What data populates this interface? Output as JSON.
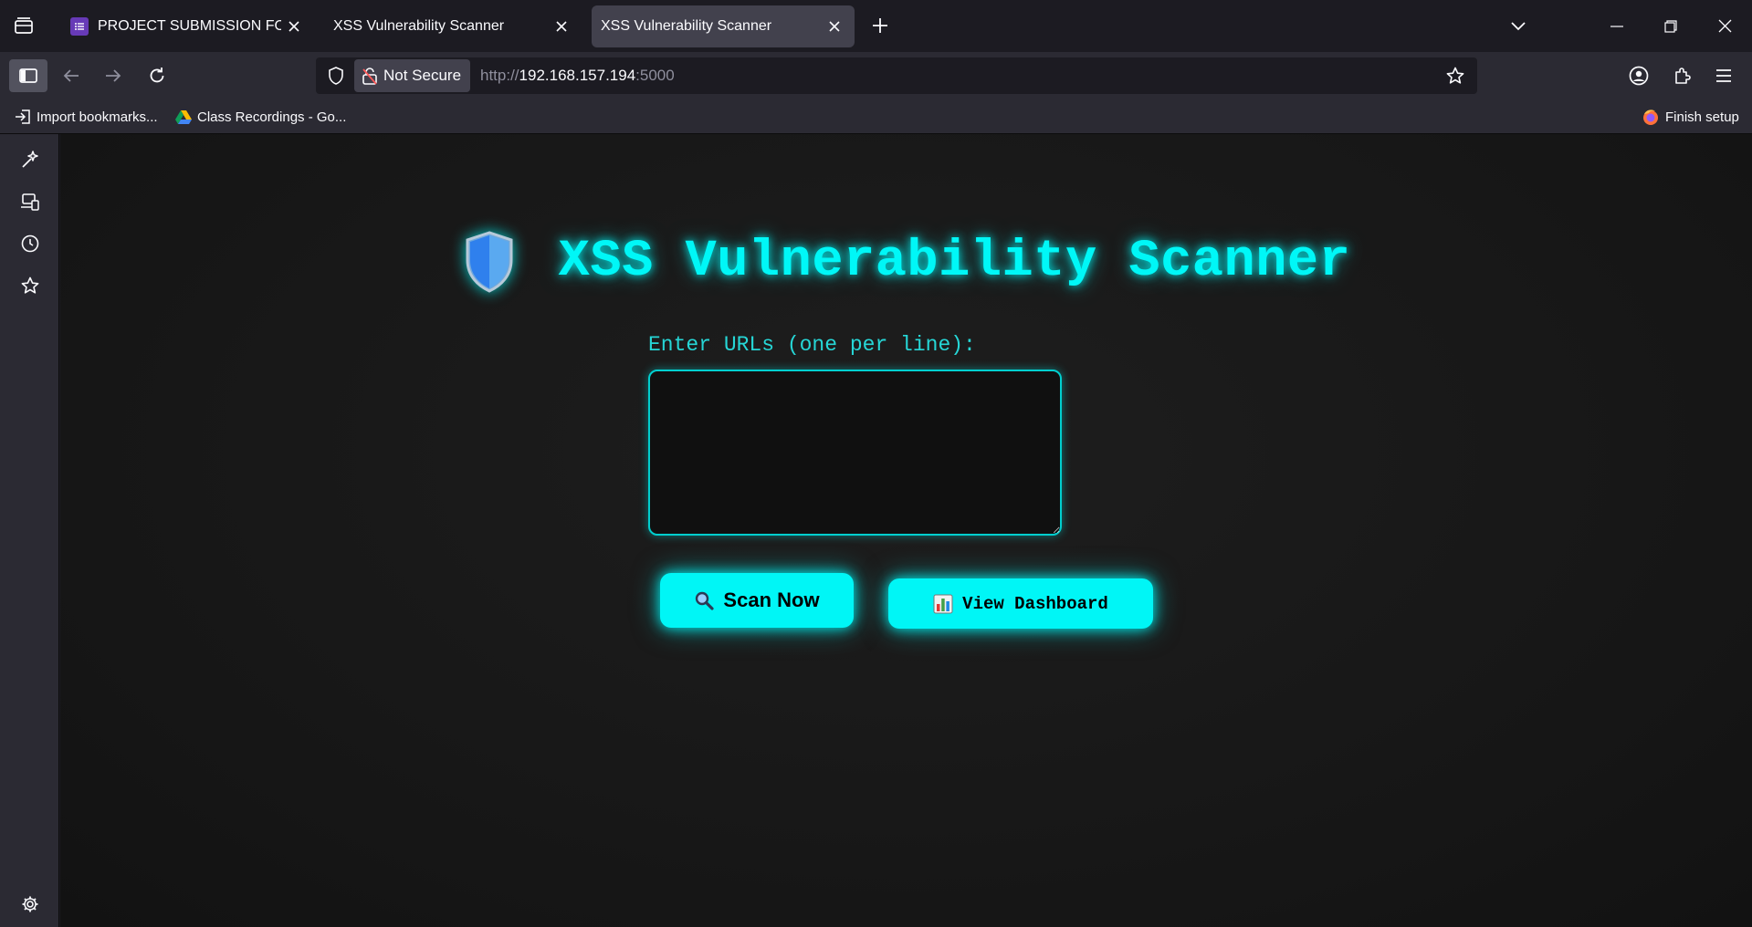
{
  "tabs": [
    {
      "title": "PROJECT SUBMISSION FORM",
      "favicon": "forms-icon",
      "active": false
    },
    {
      "title": "XSS Vulnerability Scanner",
      "favicon": "none",
      "active": false
    },
    {
      "title": "XSS Vulnerability Scanner",
      "favicon": "none",
      "active": true
    }
  ],
  "navbar": {
    "security_label": "Not Secure",
    "url_scheme": "http://",
    "url_host": "192.168.157.194",
    "url_port": ":5000"
  },
  "bookmarks": {
    "import_label": "Import bookmarks...",
    "class_recordings_label": "Class Recordings - Go...",
    "finish_setup_label": "Finish setup"
  },
  "page": {
    "title": "XSS Vulnerability Scanner",
    "urls_label": "Enter URLs (one per line):",
    "urls_value": "",
    "scan_button": "Scan Now",
    "dashboard_button": "View Dashboard"
  },
  "colors": {
    "accent": "#00f6f6",
    "background": "#161616",
    "browser_chrome": "#2b2a33",
    "tabstrip": "#1c1b22"
  }
}
